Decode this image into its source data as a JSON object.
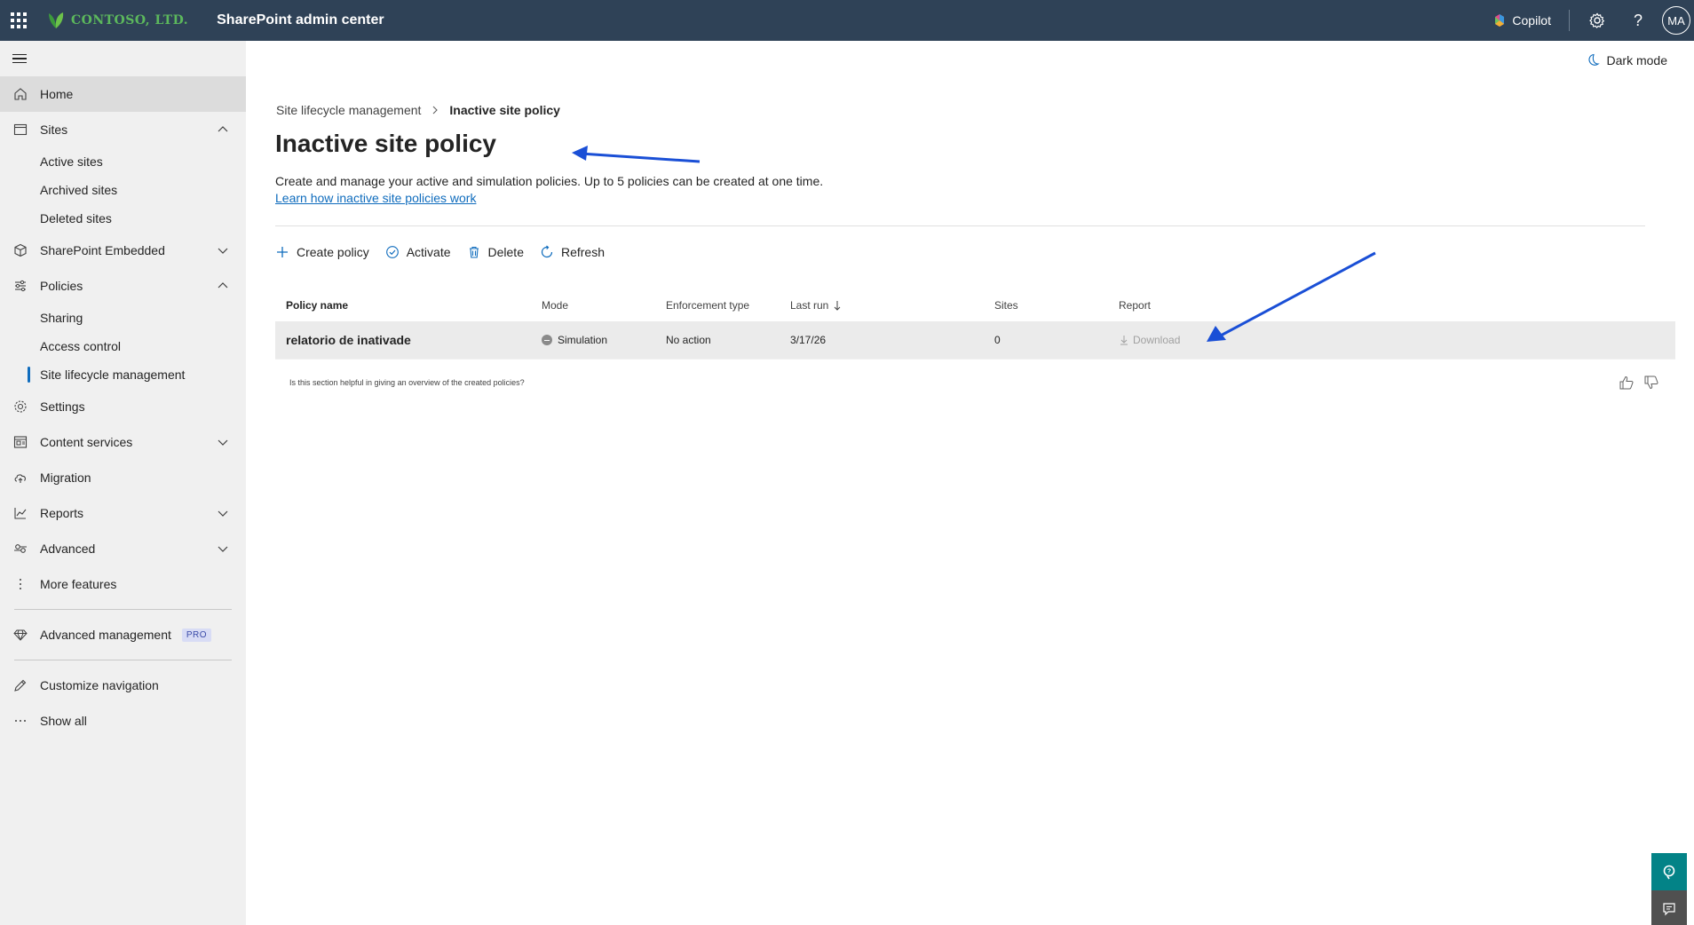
{
  "topbar": {
    "org_name": "CONTOSO, LTD.",
    "app_title": "SharePoint admin center",
    "copilot_label": "Copilot",
    "avatar_initials": "MA",
    "icons": [
      "waffle-icon",
      "leaf-logo-icon",
      "copilot-icon",
      "gear-icon",
      "help-icon"
    ]
  },
  "sidebar": {
    "items": [
      {
        "label": "Home",
        "icon": "home-icon"
      },
      {
        "label": "Sites",
        "icon": "sites-icon",
        "expanded": true,
        "children": [
          "Active sites",
          "Archived sites",
          "Deleted sites"
        ]
      },
      {
        "label": "SharePoint Embedded",
        "icon": "cube-icon",
        "expanded": false
      },
      {
        "label": "Policies",
        "icon": "sliders-icon",
        "expanded": true,
        "children": [
          "Sharing",
          "Access control",
          "Site lifecycle management"
        ]
      },
      {
        "label": "Settings",
        "icon": "gear-icon"
      },
      {
        "label": "Content services",
        "icon": "content-icon",
        "expanded": false
      },
      {
        "label": "Migration",
        "icon": "cloud-upload-icon"
      },
      {
        "label": "Reports",
        "icon": "chart-icon",
        "expanded": false
      },
      {
        "label": "Advanced",
        "icon": "advanced-icon",
        "expanded": false
      },
      {
        "label": "More features",
        "icon": "more-vertical-icon"
      }
    ],
    "advanced_management": {
      "label": "Advanced management",
      "badge": "PRO"
    },
    "customize": "Customize navigation",
    "show_all": "Show all"
  },
  "main": {
    "dark_mode_label": "Dark mode",
    "breadcrumb": {
      "parent": "Site lifecycle management",
      "current": "Inactive site policy"
    },
    "title": "Inactive site policy",
    "description": "Create and manage your active and simulation policies. Up to 5 policies can be created at one time.",
    "learn_link": "Learn how inactive site policies work",
    "commands": {
      "create": "Create policy",
      "activate": "Activate",
      "delete": "Delete",
      "refresh": "Refresh"
    },
    "table": {
      "columns": [
        "Policy name",
        "Mode",
        "Enforcement type",
        "Last run",
        "Sites",
        "Report"
      ],
      "rows": [
        {
          "name": "relatorio de inativade",
          "mode": "Simulation",
          "enforcement": "No action",
          "last_run": "3/17/26",
          "sites": "0",
          "report": "Download"
        }
      ]
    },
    "feedback_question": "Is this section helpful in giving an overview of the created policies?"
  },
  "colors": {
    "topbar_bg": "#2f4257",
    "sidebar_bg": "#f0f0f0",
    "accent": "#0f6cbd",
    "arrow": "#1a4fd6",
    "logo_green": "#5cb85c"
  }
}
